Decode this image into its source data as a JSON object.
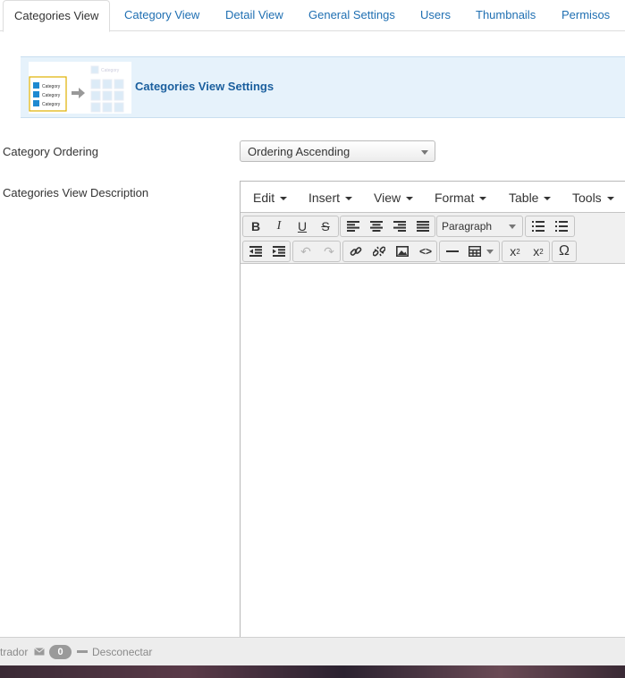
{
  "tabs": [
    {
      "label": "Categories View",
      "active": true
    },
    {
      "label": "Category View"
    },
    {
      "label": "Detail View"
    },
    {
      "label": "General Settings"
    },
    {
      "label": "Users"
    },
    {
      "label": "Thumbnails"
    },
    {
      "label": "Permisos"
    }
  ],
  "panel": {
    "title": "Categories View Settings",
    "thumbnail_labels": [
      "Category",
      "Category",
      "Category",
      "Category"
    ]
  },
  "form": {
    "ordering_label": "Category Ordering",
    "ordering_value": "Ordering Ascending",
    "description_label": "Categories View Description"
  },
  "editor": {
    "menu": [
      "Edit",
      "Insert",
      "View",
      "Format",
      "Table",
      "Tools"
    ],
    "format_select": "Paragraph",
    "toolbar_icons": [
      "bold-icon",
      "italic-icon",
      "underline-icon",
      "strikethrough-icon",
      "align-left-icon",
      "align-center-icon",
      "align-right-icon",
      "align-justify-icon",
      "bullet-list-icon",
      "numbered-list-icon",
      "outdent-icon",
      "indent-icon",
      "undo-icon",
      "redo-icon",
      "link-icon",
      "unlink-icon",
      "image-icon",
      "code-icon",
      "horizontal-rule-icon",
      "table-icon",
      "subscript-icon",
      "superscript-icon",
      "special-character-icon"
    ]
  },
  "statusbar": {
    "user_text": "trador",
    "message_count": "0",
    "logout_label": "Desconectar"
  },
  "colors": {
    "link": "#1f6fb2",
    "panel_bg": "#e6f2fb",
    "panel_title": "#1b5f9e"
  }
}
